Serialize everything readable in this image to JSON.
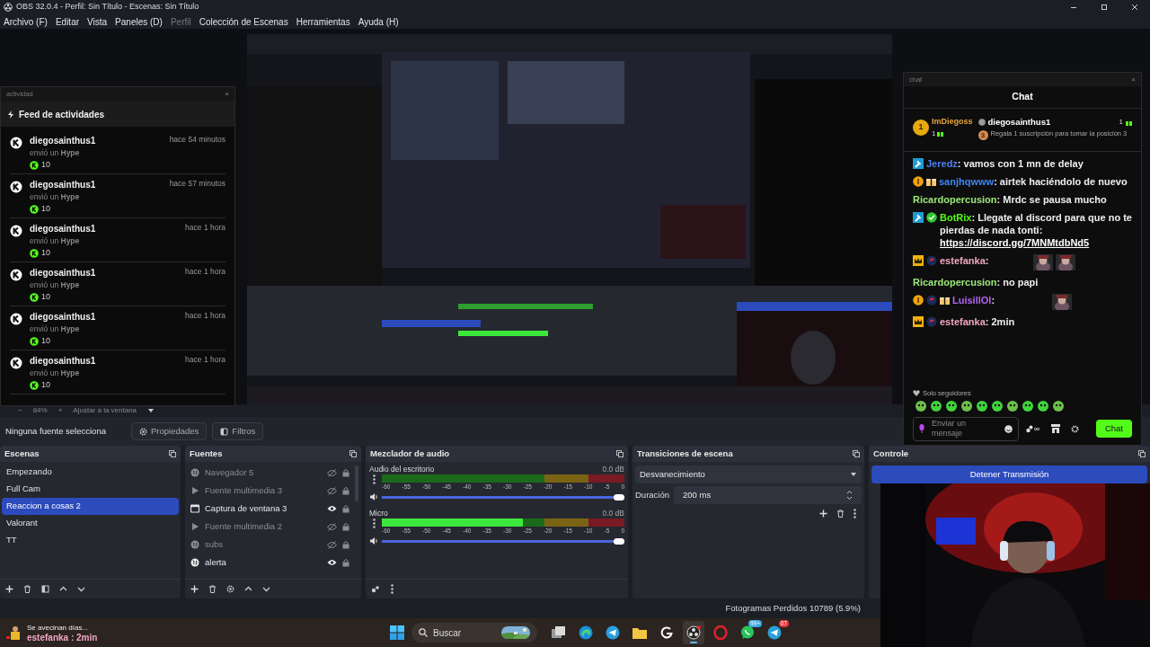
{
  "window": {
    "title": "OBS 32.0.4 - Perfil: Sin Título - Escenas: Sin Título"
  },
  "menu": [
    {
      "label": "Archivo (F)",
      "disabled": false
    },
    {
      "label": "Editar",
      "disabled": false
    },
    {
      "label": "Vista",
      "disabled": false
    },
    {
      "label": "Paneles (D)",
      "disabled": false
    },
    {
      "label": "Perfil",
      "disabled": true
    },
    {
      "label": "Colección de Escenas",
      "disabled": false
    },
    {
      "label": "Herramientas",
      "disabled": false
    },
    {
      "label": "Ayuda (H)",
      "disabled": false
    }
  ],
  "activity": {
    "window_label": "actividad",
    "close": "×",
    "title": "Feed de actividades",
    "events": [
      {
        "user": "diegosainthus1",
        "action": "envió un **Hype**",
        "amount": "10",
        "time": "hace 54 minutos"
      },
      {
        "user": "diegosainthus1",
        "action": "envió un **Hype**",
        "amount": "10",
        "time": "hace 57 minutos"
      },
      {
        "user": "diegosainthus1",
        "action": "envió un **Hype**",
        "amount": "10",
        "time": "hace 1 hora"
      },
      {
        "user": "diegosainthus1",
        "action": "envió un **Hype**",
        "amount": "10",
        "time": "hace 1 hora"
      },
      {
        "user": "diegosainthus1",
        "action": "envió un **Hype**",
        "amount": "10",
        "time": "hace 1 hora"
      },
      {
        "user": "diegosainthus1",
        "action": "envió un **Hype**",
        "amount": "10",
        "time": "hace 1 hora"
      }
    ]
  },
  "preview_capture": {
    "kind": "picture"
  },
  "chat": {
    "window_label": "chat",
    "close": "×",
    "title": "Chat",
    "leaderboard": {
      "first": {
        "rank": "1",
        "user": "ImDiegoss",
        "gifts": "1"
      },
      "second": {
        "user": "diegosainthus1",
        "gifts": "1"
      },
      "prompt": {
        "rank": "3",
        "text": "Regala 1 suscripción para tomar la posición 3"
      }
    },
    "messages": [
      {
        "badges": [
          {
            "kind": "mod"
          }
        ],
        "user": "Jeredz",
        "color": "#4a7ff0",
        "text": ": vamos con 1 mn de delay"
      },
      {
        "badges": [
          {
            "kind": "sub"
          },
          {
            "kind": "gift"
          }
        ],
        "user": "sanjhqwww",
        "color": "#3f86f5",
        "text": ": airtek haciéndolo de nuevo"
      },
      {
        "user": "Ricardopercusion",
        "color": "#9be87a",
        "text": ": Mrdc se pausa mucho"
      },
      {
        "badges": [
          {
            "kind": "mod"
          },
          {
            "kind": "verified"
          }
        ],
        "user": "BotRix",
        "color": "#53fc18",
        "text": ": Llegate al discord para que no te pierdas de nada tonti:",
        "link": "https://discord.gg/7MNMtdbNd5"
      },
      {
        "badges": [
          {
            "kind": "crown"
          },
          {
            "kind": "flag"
          }
        ],
        "user": "estefanka",
        "color": "#f2a7c3",
        "text": ":",
        "emotes": [
          {
            "kind": "picture"
          },
          {
            "kind": "picture"
          }
        ]
      },
      {
        "user": "Ricardopercusion",
        "color": "#9be87a",
        "text": ": no papi"
      },
      {
        "badges": [
          {
            "kind": "sub"
          },
          {
            "kind": "flag"
          },
          {
            "kind": "gift"
          }
        ],
        "user": "LuisillOl",
        "color": "#b463f2",
        "text": ":",
        "emotes": [
          {
            "kind": "picture"
          }
        ]
      },
      {
        "badges": [
          {
            "kind": "crown"
          },
          {
            "kind": "flag"
          }
        ],
        "user": "estefanka",
        "color": "#f2a7c3",
        "text": ": 2min"
      }
    ],
    "mode": "Solo seguidores",
    "input": {
      "placeholder": "Enviar un mensaje"
    },
    "send": "Chat"
  },
  "zoom": {
    "out": "−",
    "value": "84%",
    "in": "+",
    "fit": "Ajustar a la ventana"
  },
  "source_toolbar": {
    "selection": "Ninguna fuente selecciona",
    "buttons": [
      {
        "kind": "properties",
        "label": "Propiedades"
      },
      {
        "kind": "filters",
        "label": "Filtros"
      }
    ]
  },
  "scenes": {
    "title": "Escenas",
    "items": [
      {
        "label": "Empezando",
        "selected": false
      },
      {
        "label": "Full Cam",
        "selected": false
      },
      {
        "label": "Reaccion a cosas 2",
        "selected": true
      },
      {
        "label": "Valorant",
        "selected": false
      },
      {
        "label": "TT",
        "selected": false
      }
    ]
  },
  "sources": {
    "title": "Fuentes",
    "items": [
      {
        "kind": "browser",
        "label": "Navegador 5",
        "visible": false
      },
      {
        "kind": "media",
        "label": "Fuente multimedia 3",
        "visible": false
      },
      {
        "kind": "window",
        "label": "Captura de ventana 3",
        "visible": true
      },
      {
        "kind": "media",
        "label": "Fuente multimedia 2",
        "visible": false
      },
      {
        "kind": "browser",
        "label": "subs",
        "visible": false
      },
      {
        "kind": "browser",
        "label": "alerta",
        "visible": true
      }
    ]
  },
  "mixer": {
    "title": "Mezclador de audio",
    "channels": [
      {
        "name": "Audio del escritorio",
        "reading": "0.0 dB",
        "meter": {
          "level": 0
        },
        "volume": {
          "level": 1
        },
        "scale": [
          "-60",
          "-55",
          "-50",
          "-45",
          "-40",
          "-35",
          "-30",
          "-25",
          "-20",
          "-15",
          "-10",
          "-5",
          "0"
        ]
      },
      {
        "name": "Micro",
        "reading": "0.0 dB",
        "meter": {
          "level": 0.58
        },
        "volume": {
          "level": 1
        },
        "scale": [
          "-60",
          "-55",
          "-50",
          "-45",
          "-40",
          "-35",
          "-30",
          "-25",
          "-20",
          "-15",
          "-10",
          "-5",
          "0"
        ]
      }
    ]
  },
  "transitions": {
    "title": "Transiciones de escena",
    "type": "Desvanecimiento",
    "duration_label": "Duración",
    "duration": "200 ms"
  },
  "controls": {
    "title": "Controle",
    "buttons": [
      "Detener Transmisión"
    ]
  },
  "status_bar": {
    "dropped": "Fotogramas Perdidos 10789 (5.9%)"
  },
  "taskbar": {
    "notification": {
      "title": "Se avecinan días...",
      "text": "estefanka : 2min"
    },
    "search": {
      "placeholder": "Buscar"
    },
    "apps": [
      {
        "kind": "taskview",
        "active": false
      },
      {
        "kind": "edge",
        "active": false
      },
      {
        "kind": "telegram",
        "active": false
      },
      {
        "kind": "files",
        "active": false
      },
      {
        "kind": "logitech",
        "active": false
      },
      {
        "kind": "obs",
        "active": true
      },
      {
        "kind": "opera",
        "active": false
      },
      {
        "kind": "whatsapp",
        "active": false,
        "badge": "99+"
      },
      {
        "kind": "telegram",
        "active": false,
        "badge": "07"
      }
    ]
  },
  "webcam": {
    "kind": "picture"
  }
}
